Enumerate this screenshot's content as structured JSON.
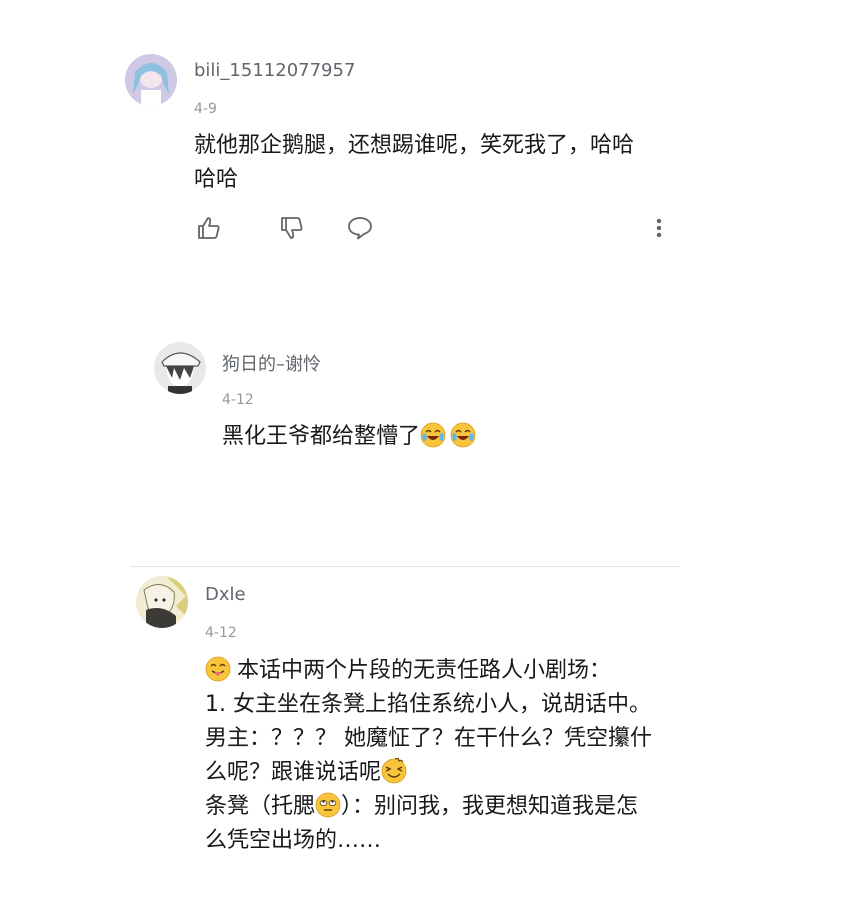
{
  "comments": [
    {
      "username": "bili_15112077957",
      "date": "4-9",
      "lines": [
        "就他那企鹅腿，还想踢谁呢，笑死我了，哈哈",
        "哈哈"
      ]
    },
    {
      "username": "狗日的–谢怜",
      "date": "4-12",
      "text": "黑化王爷都给整懵了"
    },
    {
      "username": "Dxle",
      "date": "4-12",
      "line1": "本话中两个片段的无责任路人小剧场：",
      "line2": "1.  女主坐在条凳上掐住系统小人，说胡话中。",
      "line3": "男主：？？？ 她魔怔了？在干什么？凭空攥什",
      "line4": "么呢？跟谁说话呢",
      "line5a": "条凳（托腮",
      "line5b": "）：别问我，我更想知道我是怎",
      "line6": "么凭空出场的……"
    }
  ],
  "icons": {
    "like": "thumbs-up-icon",
    "dislike": "thumbs-down-icon",
    "reply": "speech-bubble-icon",
    "more": "vertical-dots-icon",
    "emoji_cry": "crying-laughing-emoji",
    "emoji_tongue": "tongue-out-emoji",
    "emoji_dizzy": "dizzy-emoji",
    "emoji_eyeroll": "eye-roll-emoji"
  },
  "colors": {
    "username": "#61666d",
    "date": "#9499a0",
    "text": "#18191c",
    "divider": "#e3e5e7",
    "icon": "#61666d"
  }
}
